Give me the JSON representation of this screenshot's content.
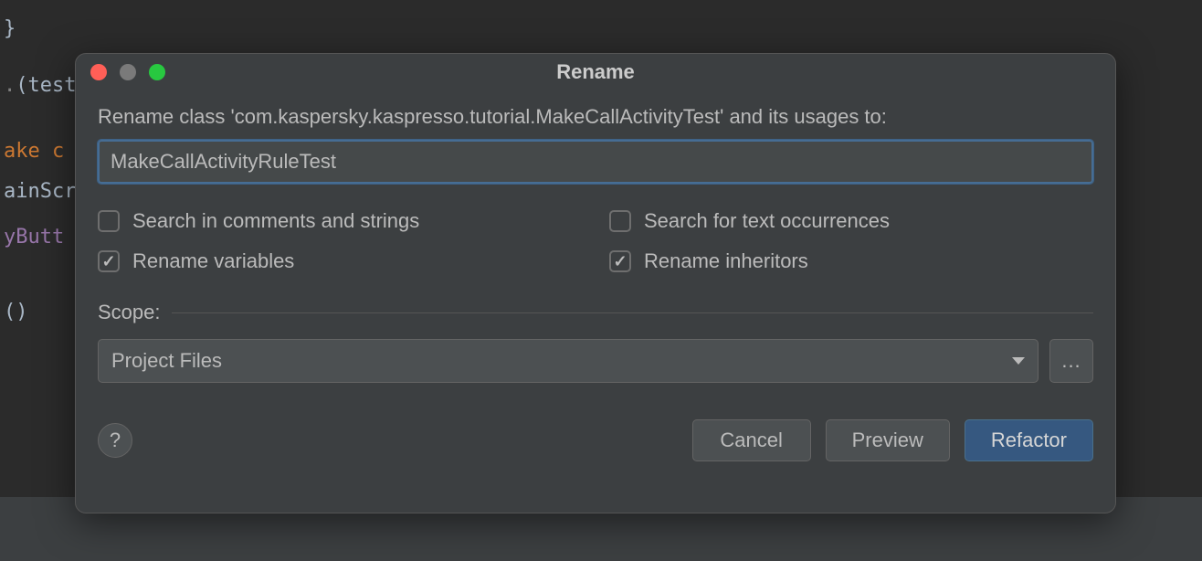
{
  "editor": {
    "line1": "}",
    "line2_pre": ".",
    "line2_paren_open": "(",
    "line2_var": "test",
    "line3_kw": "ake c",
    "line4": "ainScr",
    "line5": "yButt",
    "line6": "()"
  },
  "dialog": {
    "title": "Rename",
    "prompt": "Rename class 'com.kaspersky.kaspresso.tutorial.MakeCallActivityTest' and its usages to:",
    "input_value": "MakeCallActivityRuleTest",
    "checkboxes": {
      "search_comments": {
        "label": "Search in comments and strings",
        "checked": false
      },
      "search_text": {
        "label": "Search for text occurrences",
        "checked": false
      },
      "rename_variables": {
        "label": "Rename variables",
        "checked": true
      },
      "rename_inheritors": {
        "label": "Rename inheritors",
        "checked": true
      }
    },
    "scope": {
      "label": "Scope:",
      "value": "Project Files",
      "more": "..."
    },
    "footer": {
      "help": "?",
      "cancel": "Cancel",
      "preview": "Preview",
      "refactor": "Refactor"
    }
  }
}
